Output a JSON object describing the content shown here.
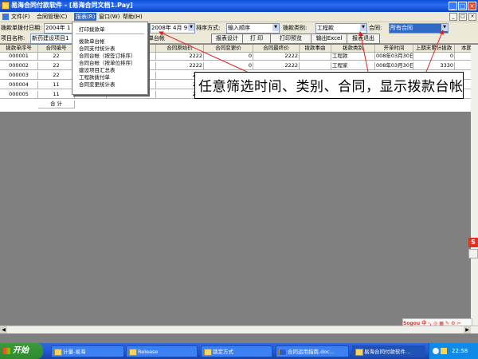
{
  "window": {
    "title": "易海合同付款软件 - [易海合同文档1.Pay]"
  },
  "menubar": {
    "items": [
      "文件(F)",
      "合同管理(C)",
      "报表(R)",
      "窗口(W)",
      "帮助(H)"
    ],
    "mdi_controls": [
      "_",
      "□",
      "×"
    ]
  },
  "toolbar": {
    "date_label": "拨款单拨付日期:",
    "date_from": "2004年 1",
    "date_to": "2008年 4月 9日",
    "sort_label": "排序方式:",
    "sort_value": "输入顺序",
    "category_label": "拨款类别:",
    "category_value": "工程款",
    "contract_label": "合同:",
    "contract_value": "所有合同",
    "project_label": "项目名称:",
    "project_value": "新药建设项目1",
    "report_title": "单台帐",
    "buttons": [
      "报表设计",
      "打 印",
      "打印预览",
      "输出Excel",
      "报表退出"
    ]
  },
  "dropdown": {
    "items": [
      "打印拨款单",
      "拨款单台帐",
      "合同支付统计表",
      "合同台帐（按签订排序）",
      "合同台帐（按单位排序）",
      "建设项目汇总表",
      "工程款拨付单",
      "合同变更统计表"
    ]
  },
  "grid": {
    "columns": [
      "拨款单序号",
      "合同编号",
      "",
      "",
      "合同原始价",
      "合同变更价",
      "合同最终价",
      "拨款事由",
      "拨款类别",
      "开单时间",
      "上期末累计拨款",
      "本期"
    ],
    "rows": [
      [
        "000001",
        "22",
        "",
        "",
        "2222",
        "0",
        "2222",
        "",
        "工程款",
        "008年03月30日",
        "0",
        ""
      ],
      [
        "000002",
        "22",
        "",
        "",
        "2222",
        "0",
        "2222",
        "",
        "工程家",
        "008年03月30日",
        "3330",
        ""
      ],
      [
        "000003",
        "22",
        "",
        "",
        "222",
        "0",
        "2222",
        "",
        "",
        "",
        "",
        ""
      ],
      [
        "000004",
        "11",
        "",
        "",
        "222",
        "0",
        "",
        "",
        "",
        "",
        "",
        ""
      ],
      [
        "000005",
        "11",
        "",
        "",
        "222",
        "0",
        "",
        "",
        "",
        "",
        "",
        ""
      ]
    ],
    "total_label": "合 计"
  },
  "callout": {
    "text": "任意筛选时间、类别、合同，显示拨款台帐"
  },
  "ime": {
    "label": "Sogou 中 ·, ◎ ▦ ✎ ⚙ ✂"
  },
  "taskbar": {
    "start_label": "开始",
    "tasks": [
      "计量-易海",
      "Release",
      "锁定方式",
      "合同运用指南.doc...",
      "易海合同付款软件..."
    ],
    "clock": "22:58"
  },
  "colors": {
    "titlebar": "#0a4fd6",
    "selection": "#316ac5",
    "callout_arrow": "#e02020",
    "workspace": "#808080"
  }
}
